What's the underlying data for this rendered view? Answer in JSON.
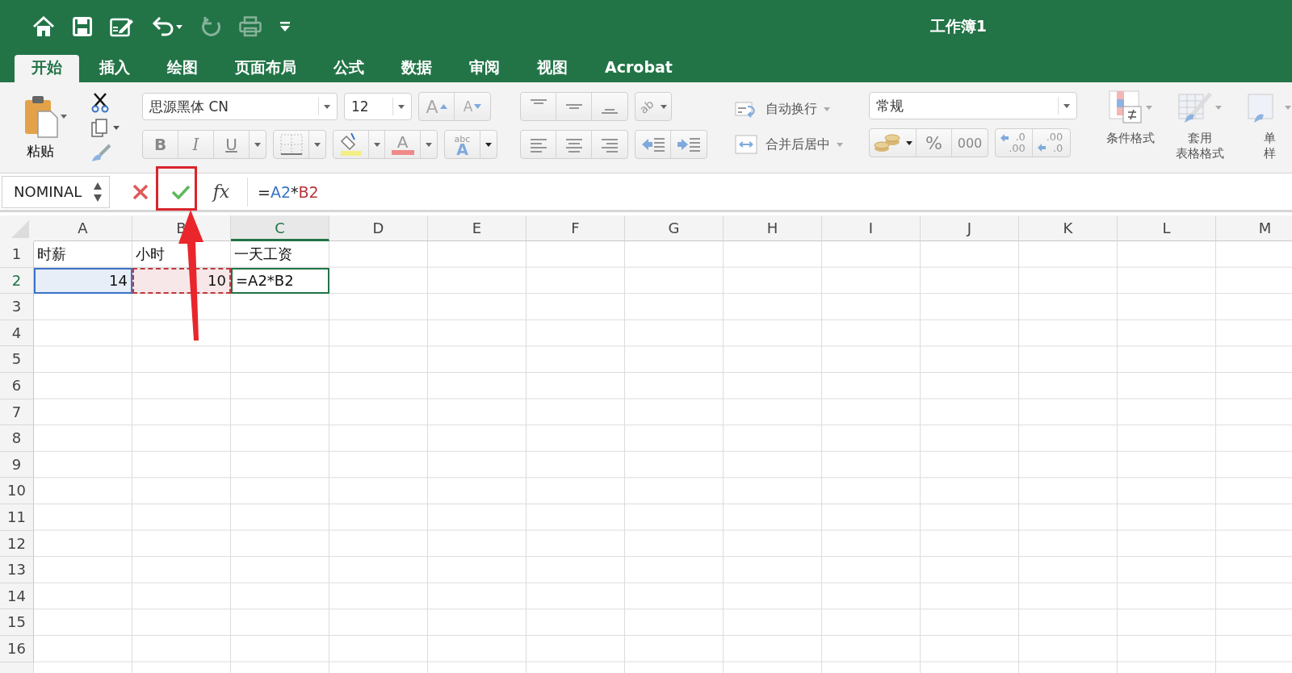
{
  "window": {
    "title": "工作簿1"
  },
  "quick_access": [
    {
      "kind": "home",
      "disabled": false
    },
    {
      "kind": "save",
      "disabled": false
    },
    {
      "kind": "edit",
      "disabled": false
    },
    {
      "kind": "undo",
      "disabled": false
    },
    {
      "kind": "redo",
      "disabled": true
    },
    {
      "kind": "print",
      "disabled": true
    },
    {
      "kind": "customize",
      "disabled": false
    }
  ],
  "tabs": [
    {
      "label": "开始",
      "selected": true
    },
    {
      "label": "插入",
      "selected": false
    },
    {
      "label": "绘图",
      "selected": false
    },
    {
      "label": "页面布局",
      "selected": false
    },
    {
      "label": "公式",
      "selected": false
    },
    {
      "label": "数据",
      "selected": false
    },
    {
      "label": "审阅",
      "selected": false
    },
    {
      "label": "视图",
      "selected": false
    },
    {
      "label": "Acrobat",
      "selected": false
    }
  ],
  "ribbon": {
    "paste_label": "粘贴",
    "font_name": "思源黑体 CN",
    "font_size": "12",
    "grow_font": "A",
    "shrink_font": "A",
    "bold": "B",
    "italic": "I",
    "underline": "U",
    "font_color": "A",
    "phonetic": [
      "abc",
      "A"
    ],
    "orientation": "ab",
    "wrap_text": "自动换行",
    "merge_center": "合并后居中",
    "number_format": "常规",
    "percent": "%",
    "thousands": "000",
    "increase_decimal": [
      ".0",
      ".00"
    ],
    "decrease_decimal": [
      ".00",
      ".0"
    ],
    "styles": [
      {
        "kind": "conditional",
        "lines": [
          "条件格式"
        ]
      },
      {
        "kind": "table",
        "lines": [
          "套用",
          "表格格式"
        ]
      },
      {
        "kind": "cell",
        "lines": [
          "单",
          "样"
        ]
      }
    ]
  },
  "formula_bar": {
    "name_box": "NOMINAL",
    "fx_label": "fx",
    "formula": [
      {
        "text": "="
      },
      {
        "text": "A2",
        "color": "#3b73c6"
      },
      {
        "text": "*"
      },
      {
        "text": "B2",
        "color": "#b8343c"
      }
    ]
  },
  "sheet": {
    "columns": [
      {
        "label": "A",
        "selected": false
      },
      {
        "label": "B",
        "selected": false
      },
      {
        "label": "C",
        "selected": true
      },
      {
        "label": "D",
        "selected": false
      },
      {
        "label": "E",
        "selected": false
      },
      {
        "label": "F",
        "selected": false
      },
      {
        "label": "G",
        "selected": false
      },
      {
        "label": "H",
        "selected": false
      },
      {
        "label": "I",
        "selected": false
      },
      {
        "label": "J",
        "selected": false
      },
      {
        "label": "K",
        "selected": false
      },
      {
        "label": "L",
        "selected": false
      },
      {
        "label": "M",
        "selected": false
      }
    ],
    "rows": [
      {
        "label": "1",
        "selected": false,
        "cells": [
          {
            "text": "时薪",
            "kind": "text"
          },
          {
            "text": "小时",
            "kind": "text"
          },
          {
            "text": "一天工资",
            "kind": "text"
          }
        ]
      },
      {
        "label": "2",
        "selected": true,
        "cells": [
          {
            "text": "14",
            "kind": "number",
            "color": "#3b73c6"
          },
          {
            "text": "10",
            "kind": "number",
            "color": "#c0393f"
          },
          {
            "text": "=A2*B2",
            "kind": "text",
            "active": true
          }
        ]
      },
      {
        "label": "3",
        "selected": false
      },
      {
        "label": "4",
        "selected": false
      },
      {
        "label": "5",
        "selected": false
      },
      {
        "label": "6",
        "selected": false
      },
      {
        "label": "7",
        "selected": false
      },
      {
        "label": "8",
        "selected": false
      },
      {
        "label": "9",
        "selected": false
      },
      {
        "label": "10",
        "selected": false
      },
      {
        "label": "11",
        "selected": false
      },
      {
        "label": "12",
        "selected": false
      },
      {
        "label": "13",
        "selected": false
      },
      {
        "label": "14",
        "selected": false
      },
      {
        "label": "15",
        "selected": false
      },
      {
        "label": "16",
        "selected": false
      }
    ]
  },
  "annotation": {
    "frame": true,
    "arrow": true
  }
}
